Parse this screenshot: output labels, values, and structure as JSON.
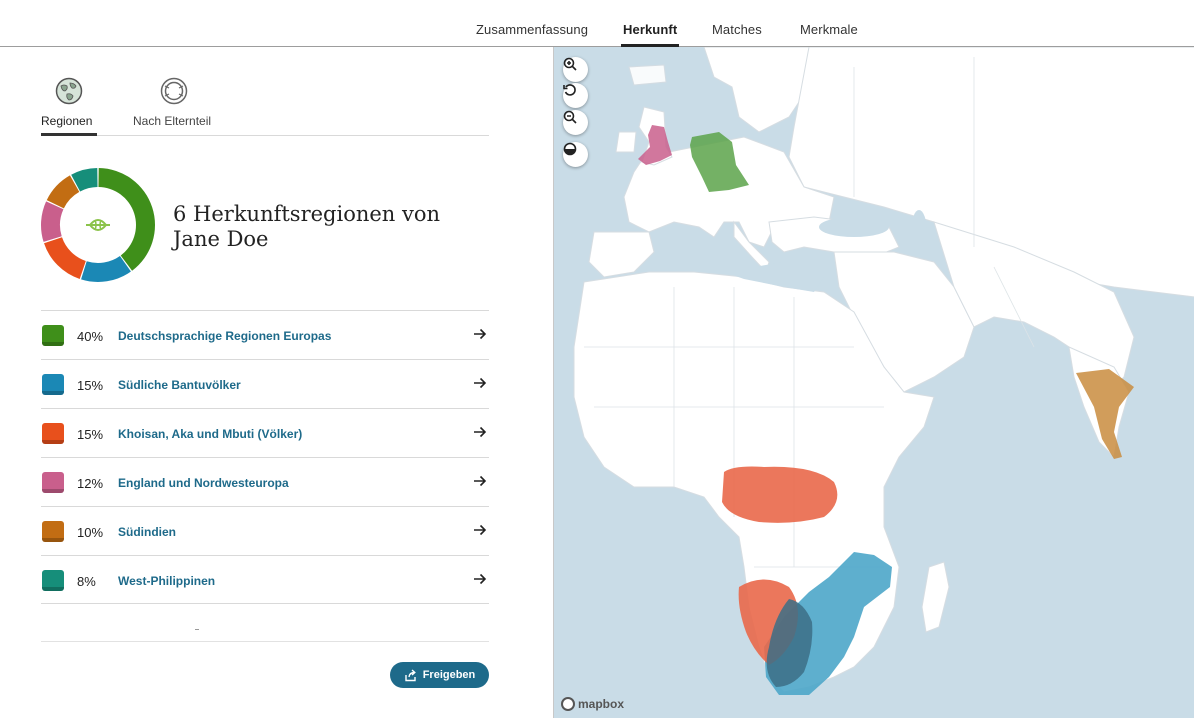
{
  "tabs": [
    {
      "label": "Zusammenfassung",
      "active": false
    },
    {
      "label": "Herkunft",
      "active": true
    },
    {
      "label": "Matches",
      "active": false
    },
    {
      "label": "Merkmale",
      "active": false
    }
  ],
  "view_toggle": {
    "regions_label": "Regionen",
    "parents_label": "Nach Elternteil"
  },
  "heading": "6 Herkunftsregionen von Jane Doe",
  "regions": [
    {
      "percent": "40%",
      "name": "Deutschsprachige Regionen Europas",
      "color": "#3f8f1a",
      "value": 40
    },
    {
      "percent": "15%",
      "name": "Südliche Bantuvölker",
      "color": "#1b88b5",
      "value": 15
    },
    {
      "percent": "15%",
      "name": "Khoisan, Aka und Mbuti (Völker)",
      "color": "#e8501c",
      "value": 15
    },
    {
      "percent": "12%",
      "name": "England und Nordwesteuropa",
      "color": "#c95f8c",
      "value": 12
    },
    {
      "percent": "10%",
      "name": "Südindien",
      "color": "#c26d13",
      "value": 10
    },
    {
      "percent": "8%",
      "name": "West-Philippinen",
      "color": "#168e7a",
      "value": 8
    }
  ],
  "share_label": "Freigeben",
  "map": {
    "attribution": "mapbox",
    "controls": [
      "zoom-in-icon",
      "reset-icon",
      "zoom-out-icon",
      "contrast-icon"
    ]
  }
}
